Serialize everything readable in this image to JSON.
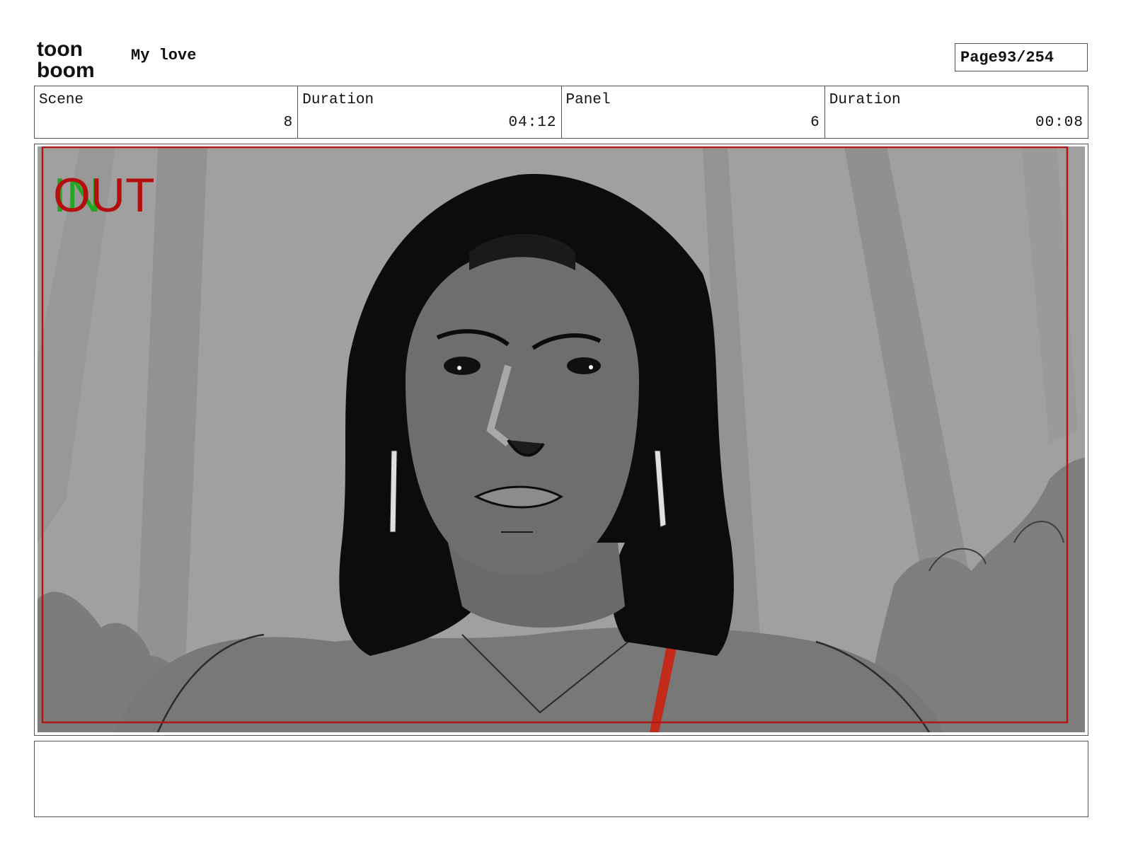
{
  "header": {
    "logo_top": "toon",
    "logo_bottom": "boom",
    "project_title": "My love",
    "page_label": "Page",
    "page_value": "93/254"
  },
  "info": {
    "scene_label": "Scene",
    "scene_value": "8",
    "scene_duration_label": "Duration",
    "scene_duration_value": "04:12",
    "panel_label": "Panel",
    "panel_value": "6",
    "panel_duration_label": "Duration",
    "panel_duration_value": "00:08"
  },
  "panel": {
    "in_marker": "IN",
    "out_marker": "OUT",
    "colors": {
      "in_marker": "#22a722",
      "out_marker": "#b40f0f",
      "safe_frame": "#b01818",
      "background": "#a0a0a0"
    }
  },
  "notes": {
    "text": ""
  }
}
